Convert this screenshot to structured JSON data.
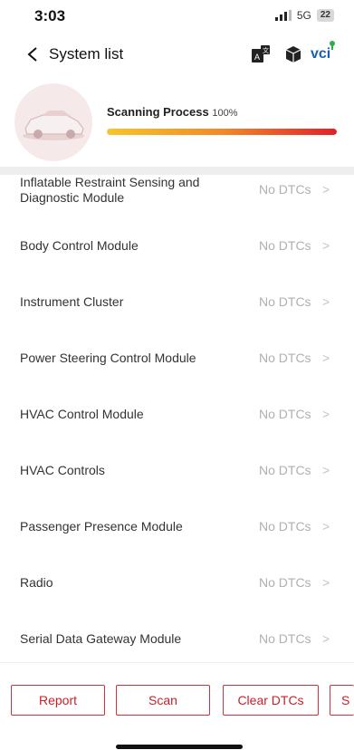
{
  "status_bar": {
    "time": "3:03",
    "network": "5G",
    "battery": "22"
  },
  "header": {
    "title": "System list",
    "vci_label": "vci"
  },
  "scan": {
    "label": "Scanning Process",
    "percent_text": "100%",
    "progress": 1.0
  },
  "modules": [
    {
      "name": "Inflatable Restraint Sensing and Diagnostic Module",
      "status": "No DTCs"
    },
    {
      "name": "Body Control Module",
      "status": "No DTCs"
    },
    {
      "name": "Instrument Cluster",
      "status": "No DTCs"
    },
    {
      "name": "Power Steering Control Module",
      "status": "No DTCs"
    },
    {
      "name": "HVAC Control Module",
      "status": "No DTCs"
    },
    {
      "name": "HVAC Controls",
      "status": "No DTCs"
    },
    {
      "name": "Passenger Presence Module",
      "status": "No DTCs"
    },
    {
      "name": "Radio",
      "status": "No DTCs"
    },
    {
      "name": "Serial Data Gateway Module",
      "status": "No DTCs"
    }
  ],
  "chevron_glyph": ">",
  "buttons": {
    "report": "Report",
    "scan": "Scan",
    "clear_dtcs": "Clear DTCs",
    "fourth_partial": "S"
  },
  "icons": [
    "back-chevron-icon",
    "translate-icon",
    "cube-icon",
    "vci-icon",
    "car-icon",
    "signal-icon",
    "battery-icon"
  ],
  "colors": {
    "accent": "#d0323c",
    "status_text": "#b0b0b0",
    "progress_start": "#f7c52a",
    "progress_end": "#e0202a"
  }
}
